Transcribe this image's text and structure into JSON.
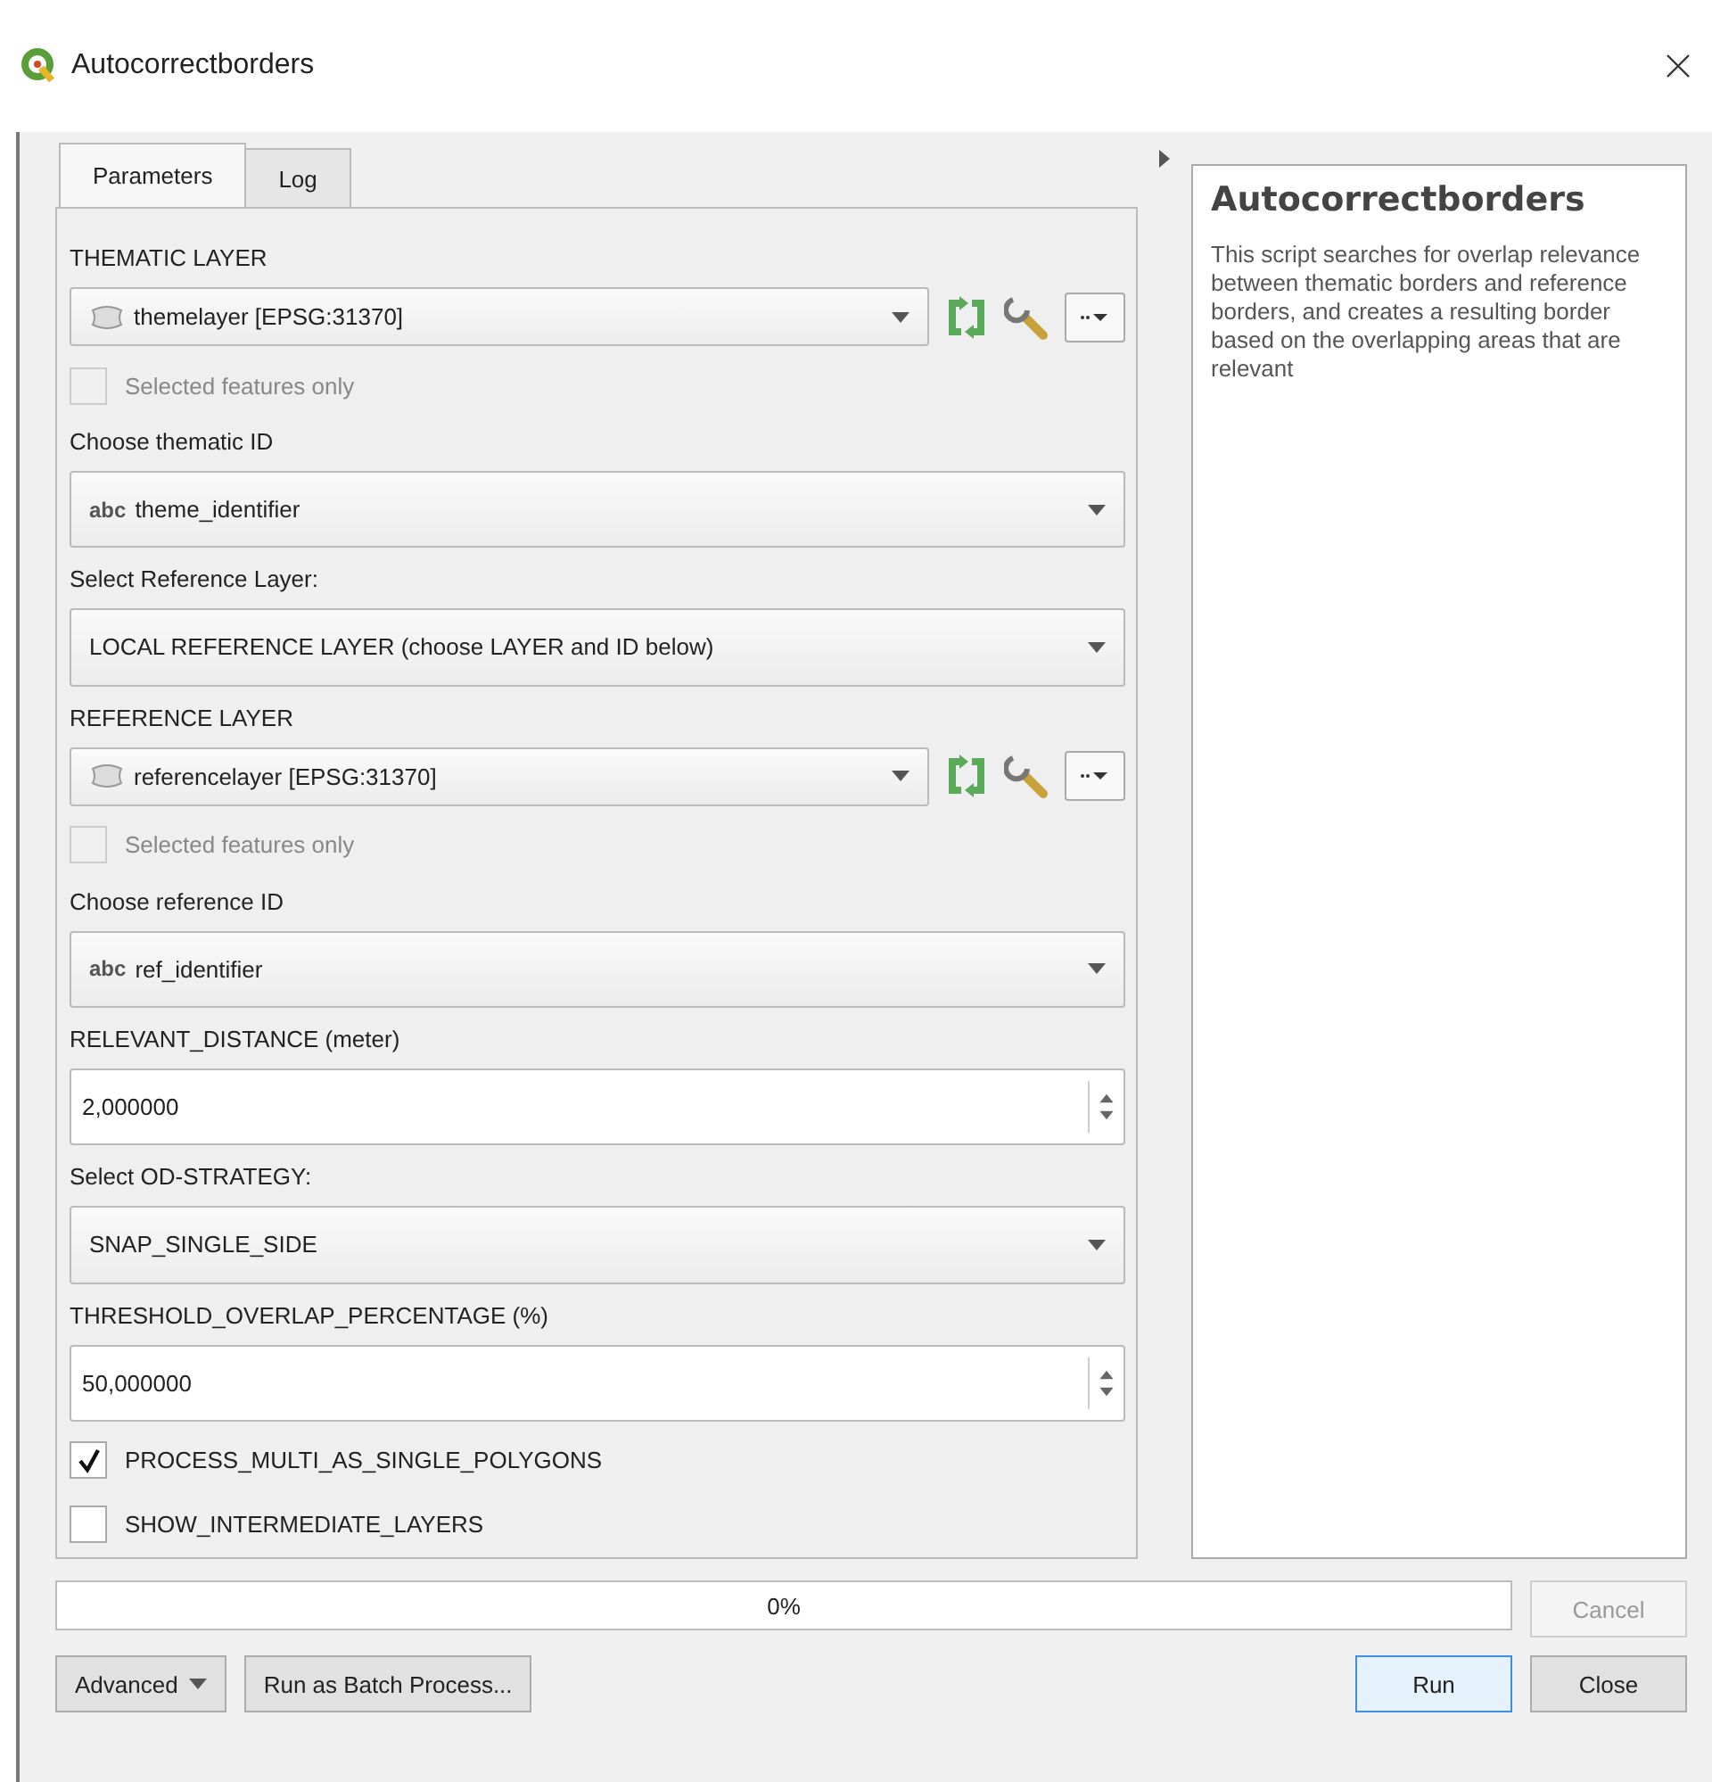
{
  "window": {
    "title": "Autocorrectborders"
  },
  "tabs": [
    {
      "label": "Parameters",
      "selected": true
    },
    {
      "label": "Log",
      "selected": false
    }
  ],
  "parameters": [
    {
      "kind": "layer",
      "label": "THEMATIC LAYER",
      "value": "themelayer [EPSG:31370]",
      "selected_only": {
        "label": "Selected features only",
        "checked": false,
        "disabled": true
      }
    },
    {
      "kind": "field",
      "label": "Choose thematic ID",
      "value": "theme_identifier",
      "type_tag": "abc"
    },
    {
      "kind": "enum",
      "label": "Select Reference Layer:",
      "value": "LOCAL REFERENCE LAYER (choose LAYER and ID below)"
    },
    {
      "kind": "layer",
      "label": "REFERENCE LAYER",
      "value": "referencelayer [EPSG:31370]",
      "selected_only": {
        "label": "Selected features only",
        "checked": false,
        "disabled": true
      }
    },
    {
      "kind": "field",
      "label": "Choose reference ID",
      "value": "ref_identifier",
      "type_tag": "abc"
    },
    {
      "kind": "number",
      "label": "RELEVANT_DISTANCE (meter)",
      "value": "2,000000"
    },
    {
      "kind": "enum",
      "label": "Select OD-STRATEGY:",
      "value": "SNAP_SINGLE_SIDE"
    },
    {
      "kind": "number",
      "label": "THRESHOLD_OVERLAP_PERCENTAGE (%)",
      "value": "50,000000"
    },
    {
      "kind": "checkbox",
      "label": "PROCESS_MULTI_AS_SINGLE_POLYGONS",
      "checked": true
    },
    {
      "kind": "checkbox",
      "label": "SHOW_INTERMEDIATE_LAYERS",
      "checked": false
    }
  ],
  "help": {
    "title": "Autocorrectborders",
    "text": "This script searches for overlap relevance between thematic borders and reference borders, and creates a resulting border based on the overlapping areas that are relevant"
  },
  "progress": {
    "level": 0,
    "text": "0%"
  },
  "buttons": [
    {
      "label": "Cancel",
      "disabled": true
    },
    {
      "label": "Advanced",
      "menu": true
    },
    {
      "label": "Run as Batch Process...",
      "menu": false
    },
    {
      "label": "Run",
      "default": true
    },
    {
      "label": "Close",
      "default": false
    }
  ]
}
